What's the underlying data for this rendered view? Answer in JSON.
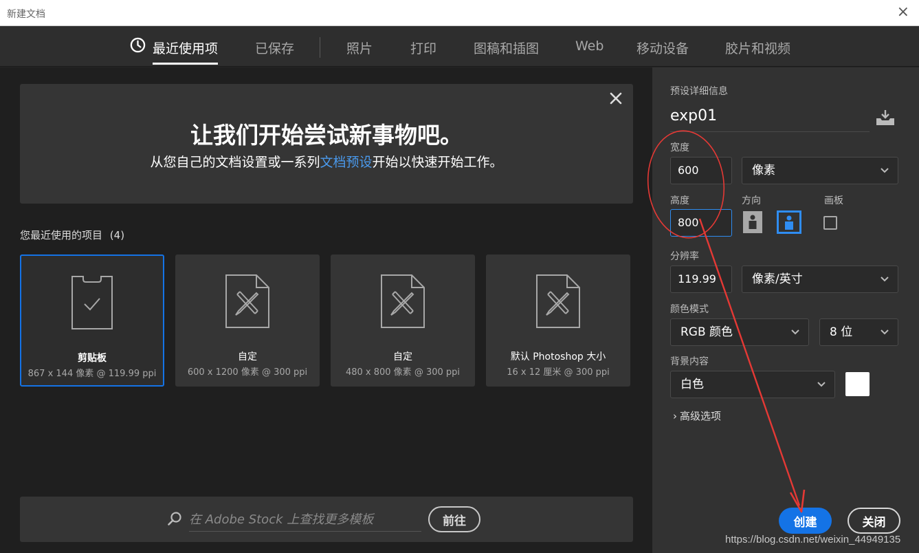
{
  "window": {
    "title": "新建文档",
    "close_glyph": "×"
  },
  "tabs": [
    {
      "label": "最近使用项",
      "active": true,
      "icon": "clock-icon"
    },
    {
      "label": "已保存"
    },
    {
      "label": "照片"
    },
    {
      "label": "打印"
    },
    {
      "label": "图稿和插图"
    },
    {
      "label": "Web"
    },
    {
      "label": "移动设备"
    },
    {
      "label": "胶片和视频"
    }
  ],
  "banner": {
    "headline": "让我们开始尝试新事物吧。",
    "text_before": "从您自己的文档设置或一系列",
    "link": "文档预设",
    "text_after": "开始以快速开始工作。"
  },
  "recent": {
    "title": "您最近使用的项目",
    "count": "(4)",
    "items": [
      {
        "name": "剪贴板",
        "meta": "867 x 144 像素 @ 119.99 ppi",
        "icon": "clipboard-check-icon",
        "selected": true
      },
      {
        "name": "自定",
        "meta": "600 x 1200 像素 @ 300 ppi",
        "icon": "document-ruler-pencil-icon"
      },
      {
        "name": "自定",
        "meta": "480 x 800 像素 @ 300 ppi",
        "icon": "document-ruler-pencil-icon"
      },
      {
        "name": "默认 Photoshop 大小",
        "meta": "16 x 12 厘米 @ 300 ppi",
        "icon": "document-ruler-pencil-icon"
      }
    ]
  },
  "search": {
    "placeholder": "在 Adobe Stock 上查找更多模板",
    "go_label": "前往"
  },
  "preset": {
    "section_title": "预设详细信息",
    "name": "exp01",
    "width_label": "宽度",
    "width_value": "600",
    "width_unit": "像素",
    "height_label": "高度",
    "height_value": "800",
    "orientation_label": "方向",
    "artboard_label": "画板",
    "resolution_label": "分辨率",
    "resolution_value": "119.99",
    "resolution_unit": "像素/英寸",
    "color_mode_label": "颜色模式",
    "color_mode_value": "RGB 颜色",
    "bit_depth_value": "8 位",
    "background_label": "背景内容",
    "background_value": "白色",
    "advanced_label": "高级选项"
  },
  "actions": {
    "create_label": "创建",
    "close_label": "关闭"
  },
  "watermark": "https://blog.csdn.net/weixin_44949135",
  "colors": {
    "accent": "#1473e6",
    "link": "#4a9aed",
    "annotation": "#e53935"
  }
}
